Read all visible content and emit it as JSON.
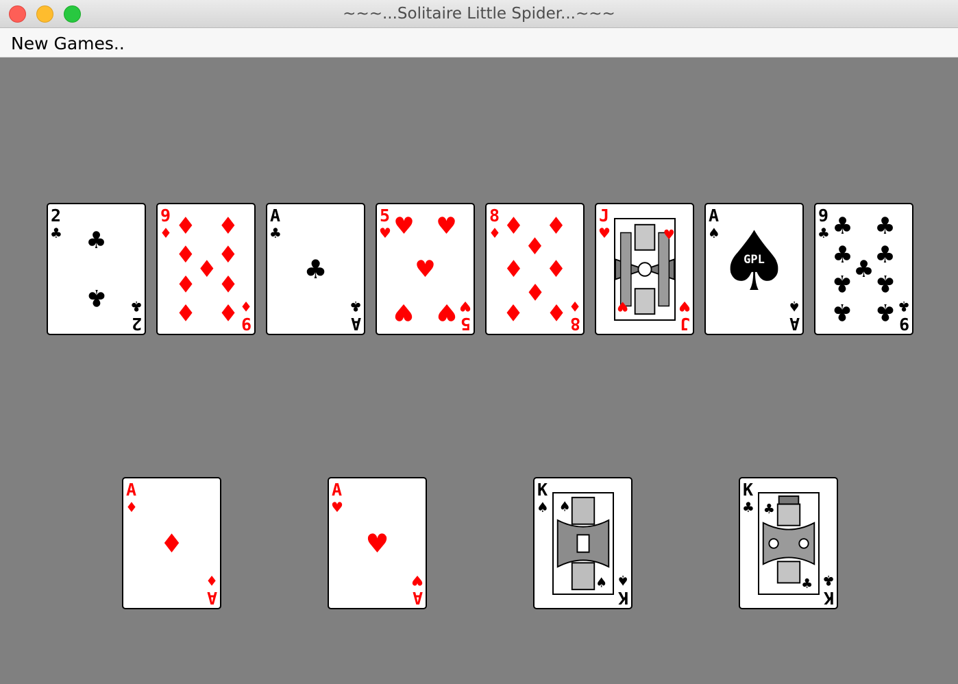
{
  "window": {
    "title": "~~~...Solitaire Little Spider...~~~"
  },
  "menu": {
    "new_games": "New Games.."
  },
  "glyphs": {
    "spade": "♠",
    "heart": "♥",
    "diamond": "♦",
    "club": "♣"
  },
  "colors": {
    "felt": "#808080",
    "red_suit": "#ff0000",
    "black_suit": "#000000"
  },
  "tableau": [
    {
      "rank": "2",
      "suit": "club"
    },
    {
      "rank": "9",
      "suit": "diamond"
    },
    {
      "rank": "A",
      "suit": "club"
    },
    {
      "rank": "5",
      "suit": "heart"
    },
    {
      "rank": "8",
      "suit": "diamond"
    },
    {
      "rank": "J",
      "suit": "heart"
    },
    {
      "rank": "A",
      "suit": "spade",
      "logo": "GPL"
    },
    {
      "rank": "9",
      "suit": "club"
    }
  ],
  "foundations": [
    {
      "rank": "A",
      "suit": "diamond"
    },
    {
      "rank": "A",
      "suit": "heart"
    },
    {
      "rank": "K",
      "suit": "spade"
    },
    {
      "rank": "K",
      "suit": "club"
    }
  ]
}
